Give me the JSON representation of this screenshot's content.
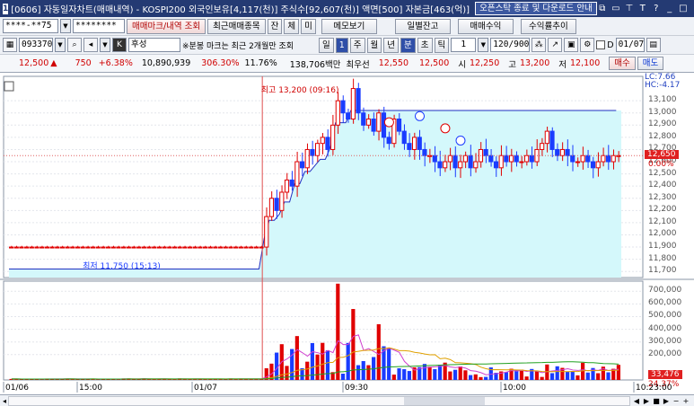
{
  "titlebar": {
    "window_num": "1",
    "title": "[0606] 자동일자차트(매매내역) - KOSPI200 외국인보유[4,117(천)] 주식수[92,607(천)] 액면[500] 자본금[463(억)]",
    "notice": "오픈스탁 종료 및 다운로드 안내"
  },
  "toolbar1": {
    "account": "****-**75",
    "password": "********",
    "buttons": [
      "매매마크/내역 조회",
      "최근매매종목",
      "잔",
      "체",
      "미",
      "메모보기",
      "일별잔고",
      "매매수익",
      "수익률추이"
    ]
  },
  "toolbar2": {
    "code": "093370",
    "name": "후성",
    "hint": "※분봉 마크는 최근 2개월만 조회",
    "periods": [
      "일",
      "1",
      "주",
      "월",
      "년",
      "분",
      "초",
      "틱"
    ],
    "selected_period": "분",
    "interval": "1",
    "count": "120/900",
    "date": "01/07",
    "date_prefix": "D"
  },
  "quote": {
    "price": "12,500",
    "change": "750",
    "change_pct": "+6.38%",
    "volume": "10,890,939",
    "vol_ratio": "306.30%",
    "turnover": "11.76%",
    "amount": "138,706백만",
    "ask_label": "최우선",
    "ask": "12,550",
    "bid": "12,500",
    "open_label": "시",
    "open": "12,250",
    "high_label": "고",
    "high": "13,200",
    "low_label": "저",
    "low": "12,100",
    "buy_btn": "매수",
    "sell_btn": "매도"
  },
  "chart_data": {
    "type": "candlestick",
    "price_axis": {
      "ticks": [
        "13,100",
        "13,000",
        "12,900",
        "12,800",
        "12,700",
        "12,600",
        "12,500",
        "12,400",
        "12,300",
        "12,200",
        "12,100",
        "12,000",
        "11,900",
        "11,800",
        "11,700"
      ],
      "tick_values": [
        13100,
        13000,
        12900,
        12800,
        12700,
        12600,
        12500,
        12400,
        12300,
        12200,
        12100,
        12000,
        11900,
        11800,
        11700
      ],
      "range": [
        11650,
        13300
      ],
      "current_label": "12,650",
      "pct_label": "0.00%",
      "lc_label": "LC:7.66",
      "hc_label": "HC:-4.17"
    },
    "volume_axis": {
      "ticks": [
        "700,000",
        "600,000",
        "500,000",
        "400,000",
        "300,000",
        "200,000"
      ],
      "tick_values": [
        700000,
        600000,
        500000,
        400000,
        300000,
        200000
      ],
      "range": [
        0,
        780000
      ],
      "current_label": "33,476",
      "ratio_label": "24.37%"
    },
    "annotations": {
      "high": "최고 13,200 (09:16)",
      "low": "최저 11,750 (15:13)"
    },
    "x_labels": [
      "01/06",
      "15:00",
      "01/07",
      "09:30",
      "10:00",
      "10:23:00"
    ],
    "series": [
      {
        "name": "price_close",
        "values": [
          11900,
          11900,
          11900,
          11900,
          11900,
          11900,
          11900,
          11900,
          11900,
          11900,
          11900,
          11900,
          11900,
          11900,
          11900,
          11900,
          11900,
          11900,
          11900,
          11900,
          11900,
          11900,
          11900,
          11900,
          11900,
          11900,
          11900,
          11900,
          11900,
          11900,
          11900,
          11900,
          11900,
          11900,
          11900,
          11900,
          11900,
          11900,
          11900,
          11900,
          11900,
          11900,
          11900,
          11900,
          11900,
          11900,
          11900,
          11900,
          11900,
          11900,
          12150,
          12300,
          12200,
          12350,
          12450,
          12400,
          12600,
          12550,
          12700,
          12650,
          12750,
          12800,
          12700,
          12900,
          13100,
          13000,
          12950,
          13200,
          13000,
          12900,
          12950,
          12850,
          13000,
          12800,
          12750,
          12950,
          12850,
          12750,
          12700,
          12800,
          12700,
          12650,
          12650,
          12600,
          12550,
          12600,
          12650,
          12550,
          12600,
          12650,
          12550,
          12600,
          12700,
          12650,
          12600,
          12550,
          12650,
          12600,
          12650,
          12600,
          12600,
          12650,
          12600,
          12700,
          12750,
          12850,
          12700,
          12650,
          12700,
          12650,
          12600,
          12600,
          12650,
          12600,
          12550,
          12600,
          12650,
          12600,
          12650,
          12650
        ]
      }
    ]
  }
}
